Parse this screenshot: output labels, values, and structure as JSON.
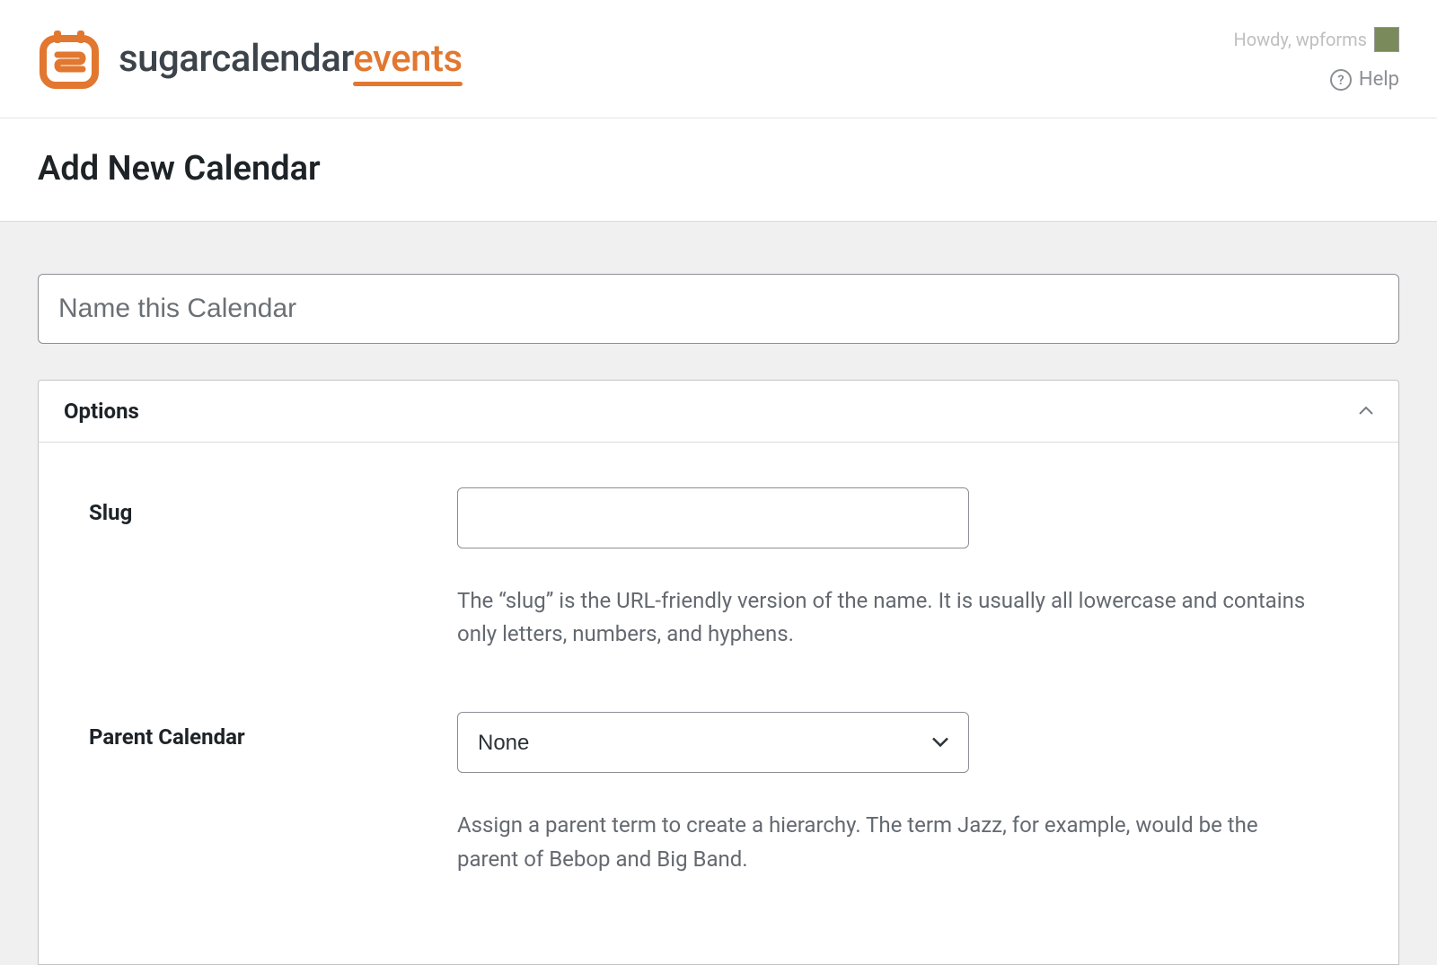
{
  "header": {
    "logo_text_main": "sugarcalendar",
    "logo_text_accent": "events",
    "howdy": "Howdy, wpforms",
    "help": "Help"
  },
  "page": {
    "title": "Add New Calendar"
  },
  "form": {
    "name_placeholder": "Name this Calendar",
    "options_title": "Options",
    "slug": {
      "label": "Slug",
      "value": "",
      "description": "The “slug” is the URL-friendly version of the name. It is usually all lowercase and contains only letters, numbers, and hyphens."
    },
    "parent": {
      "label": "Parent Calendar",
      "selected": "None",
      "description": "Assign a parent term to create a hierarchy. The term Jazz, for example, would be the parent of Bebop and Big Band."
    }
  }
}
